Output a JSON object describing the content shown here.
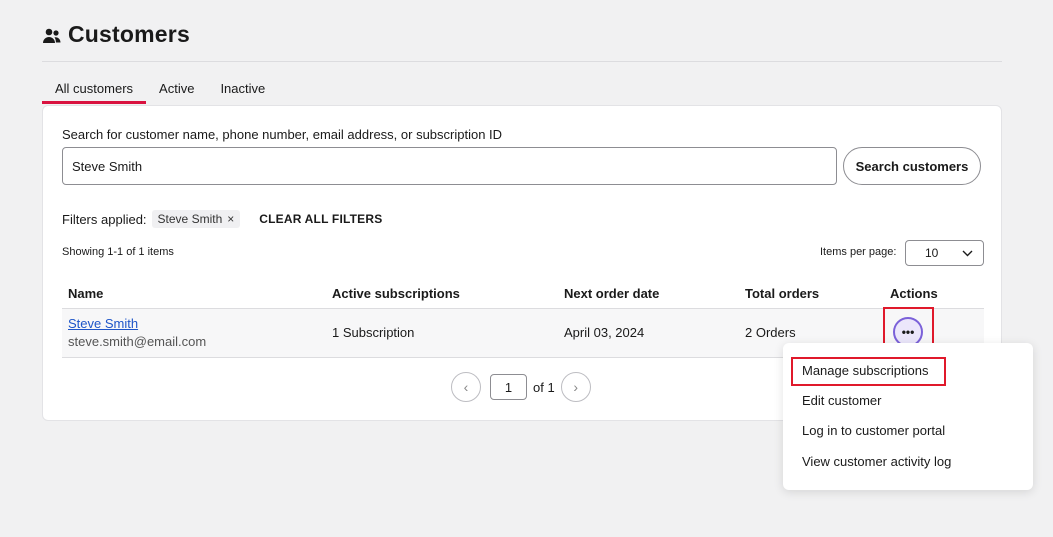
{
  "page": {
    "title": "Customers",
    "icon": "people-icon"
  },
  "tabs": [
    {
      "label": "All customers",
      "active": true
    },
    {
      "label": "Active",
      "active": false
    },
    {
      "label": "Inactive",
      "active": false
    }
  ],
  "search": {
    "label": "Search for customer name, phone number, email address, or subscription ID",
    "value": "Steve Smith",
    "button_label": "Search customers"
  },
  "filters": {
    "label": "Filters applied:",
    "chips": [
      "Steve Smith"
    ],
    "clear_all_label": "CLEAR ALL FILTERS"
  },
  "results": {
    "showing": "Showing 1-1 of 1 items",
    "per_page_label": "Items per page:",
    "per_page_value": "10"
  },
  "table": {
    "headers": [
      "Name",
      "Active subscriptions",
      "Next order date",
      "Total orders",
      "Actions"
    ],
    "rows": [
      {
        "name": "Steve Smith",
        "email": "steve.smith@email.com",
        "active_subscriptions": "1 Subscription",
        "next_order_date": "April 03, 2024",
        "total_orders": "2 Orders",
        "action_glyph": "•••"
      }
    ]
  },
  "pagination": {
    "current": "1",
    "of_label": "of 1",
    "prev_glyph": "‹",
    "next_glyph": "›"
  },
  "actions_menu": {
    "items": [
      "Manage subscriptions",
      "Edit customer",
      "Log in to customer portal",
      "View customer activity log"
    ]
  },
  "colors": {
    "accent": "#d9123f",
    "link": "#1e55c8",
    "highlight": "#e0192b",
    "action_button": "#7b61d9"
  }
}
